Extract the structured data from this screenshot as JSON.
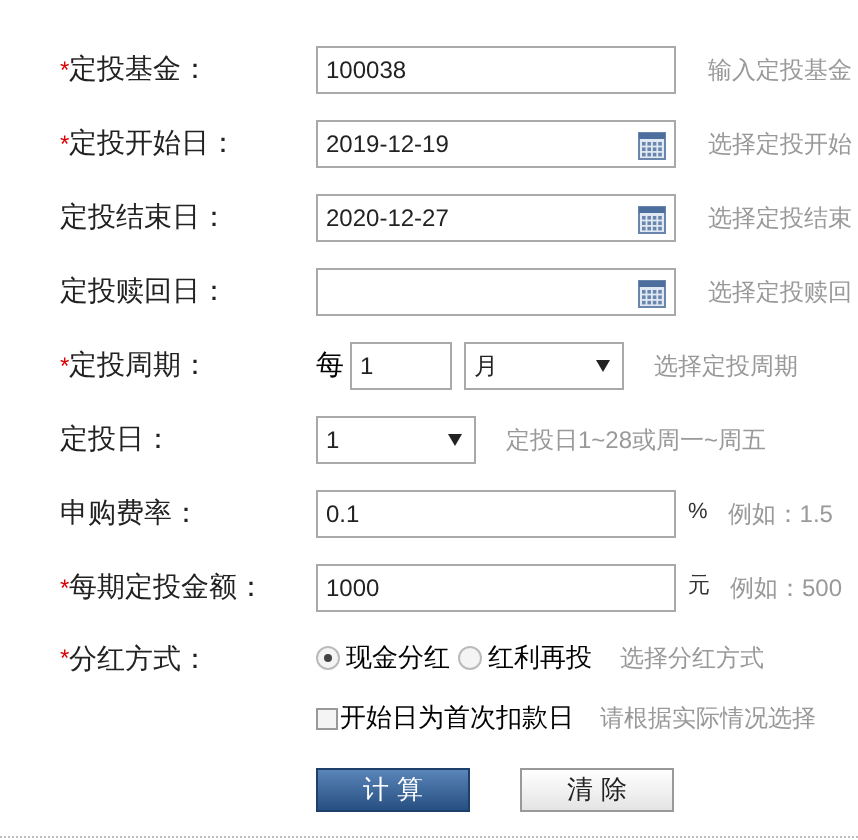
{
  "fields": [
    {
      "kind": "text",
      "mark": "*",
      "label": "定投基金：",
      "value": "100038",
      "hint": "输入定投基金"
    },
    {
      "kind": "date",
      "mark": "*",
      "label": "定投开始日：",
      "value": "2019-12-19",
      "hint": "选择定投开始"
    },
    {
      "kind": "date",
      "label": "定投结束日：",
      "value": "2020-12-27",
      "hint": "选择定投结束"
    },
    {
      "kind": "date",
      "label": "定投赎回日：",
      "hint": "选择定投赎回"
    },
    {
      "kind": "period",
      "mark": "*",
      "label": "定投周期：",
      "prefix": "每",
      "value": "1",
      "unit": "月",
      "hint": "选择定投周期"
    },
    {
      "kind": "select",
      "label": "定投日：",
      "value": "1",
      "hint": "定投日1~28或周一~周五"
    },
    {
      "kind": "text",
      "label": "申购费率：",
      "value": "0.1",
      "suffix": "%",
      "hint": "例如：1.5"
    },
    {
      "kind": "text",
      "mark": "*",
      "label": "每期定投金额：",
      "value": "1000",
      "suffix": "元",
      "hint": "例如：500"
    },
    {
      "kind": "radio",
      "mark": "*",
      "label": "分红方式：",
      "options": [
        {
          "label": "现金分红",
          "selected": true
        },
        {
          "label": "红利再投",
          "selected": false
        }
      ],
      "hint": "选择分红方式"
    },
    {
      "kind": "checkbox",
      "text": "开始日为首次扣款日",
      "checked": false,
      "hint": "请根据实际情况选择"
    }
  ],
  "buttons": [
    {
      "label": "计 算",
      "kind": "primary"
    },
    {
      "label": "清 除",
      "kind": "secondary"
    }
  ]
}
